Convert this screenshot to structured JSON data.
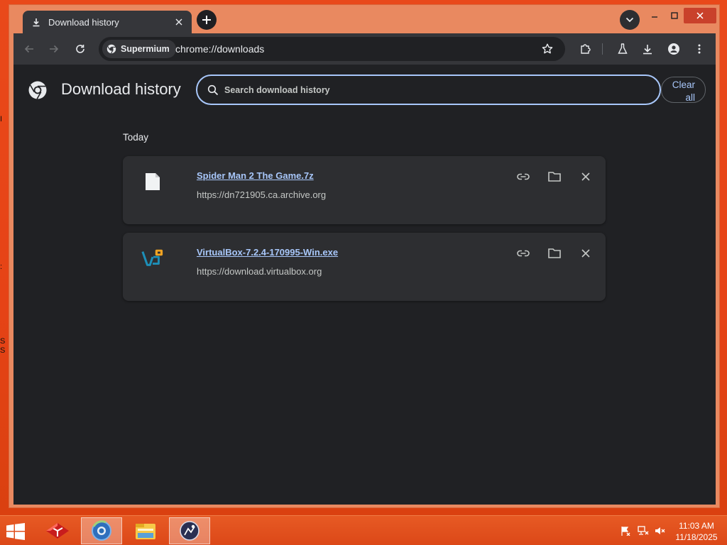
{
  "browser": {
    "tab": {
      "title": "Download history",
      "icon": "download-icon"
    },
    "omnibox": {
      "chip_label": "Supermium",
      "url": "chrome://downloads"
    }
  },
  "page": {
    "title": "Download history",
    "search": {
      "placeholder": "Search download history",
      "value": ""
    },
    "clear_all_label": "Clear\nall",
    "clear_all_line1": "Clear",
    "clear_all_line2": "all",
    "section_label": "Today",
    "downloads": [
      {
        "name": "Spider Man 2 The Game.7z",
        "url": "https://dn721905.ca.archive.org",
        "icon": "file-icon"
      },
      {
        "name": "VirtualBox-7.2.4-170995-Win.exe",
        "url": "https://download.virtualbox.org",
        "icon": "virtualbox-icon"
      }
    ]
  },
  "taskbar": {
    "apps": [
      "app-red-icon",
      "supermium-icon",
      "file-explorer-icon",
      "app-dark-icon"
    ],
    "clock": {
      "time": "11:03 AM",
      "date": "11/18/2025"
    }
  },
  "colors": {
    "accent": "#a8c7fa",
    "page_bg": "#202124",
    "card_bg": "#2d2e31",
    "desktop": "#e64316"
  }
}
